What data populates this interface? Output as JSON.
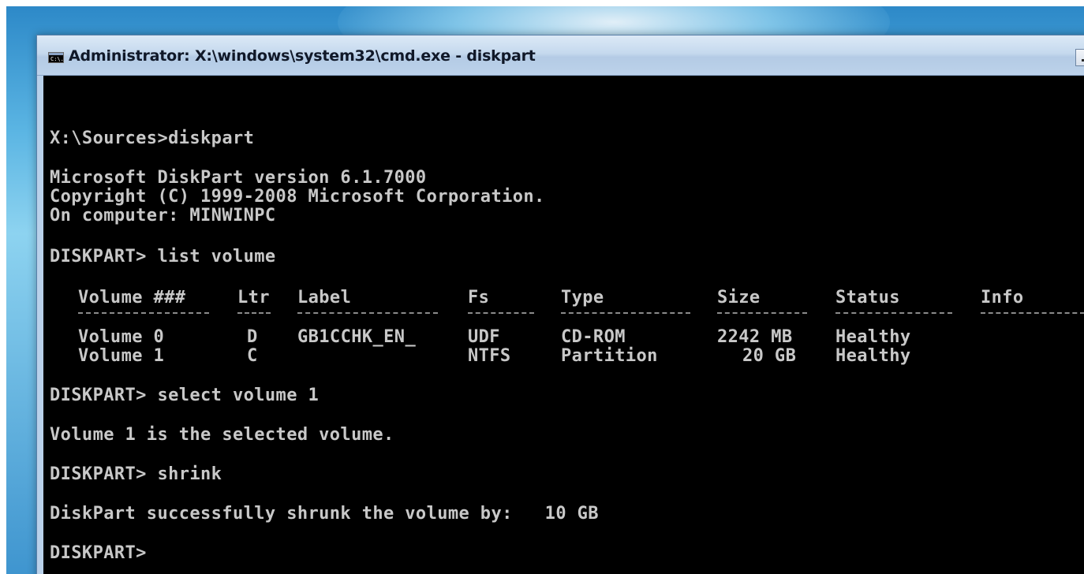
{
  "window": {
    "title": "Administrator: X:\\windows\\system32\\cmd.exe - diskpart",
    "icon": "cmd-console-icon",
    "icon_text": "C:\\."
  },
  "console": {
    "lines": {
      "prompt_diskpart": "X:\\Sources>diskpart",
      "version": "Microsoft DiskPart version 6.1.7000",
      "copyright": "Copyright (C) 1999-2008 Microsoft Corporation.",
      "computer": "On computer: MINWINPC",
      "cmd_list_volume": "DISKPART> list volume",
      "cmd_select_volume": "DISKPART> select volume 1",
      "selected_msg": "Volume 1 is the selected volume.",
      "cmd_shrink": "DISKPART> shrink",
      "shrink_msg": "DiskPart successfully shrunk the volume by:   10 GB",
      "final_prompt": "DISKPART>"
    },
    "volume_table": {
      "headers": [
        "Volume ###",
        "Ltr",
        "Label",
        "Fs",
        "Type",
        "Size",
        "Status",
        "Info"
      ],
      "rows": [
        [
          "Volume 0",
          "D",
          "GB1CCHK_EN_",
          "UDF",
          "CD-ROM",
          "2242 MB",
          "Healthy",
          ""
        ],
        [
          "Volume 1",
          "C",
          "",
          "NTFS",
          "Partition",
          "20 GB",
          "Healthy",
          ""
        ]
      ]
    }
  }
}
